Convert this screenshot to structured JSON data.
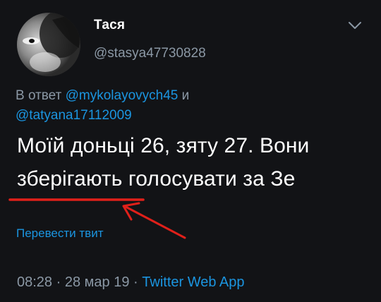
{
  "author": {
    "display_name": "Тася",
    "handle": "@stasya47730828"
  },
  "reply": {
    "prefix": "В ответ",
    "mention_1": "@mykolayovych45",
    "conjunction": "и",
    "mention_2": "@tatyana17112009"
  },
  "tweet": {
    "line_1": "Моїй доньці 26, зяту 27. Вони",
    "line_2": "зберігають голосувати за Зе"
  },
  "translate_label": "Перевести твит",
  "meta": {
    "time": "08:28",
    "separator": "·",
    "date": "28 мар 19",
    "source": "Twitter Web App"
  },
  "icons": {
    "menu": "chevron-down-icon",
    "annotation": "red-arrow"
  },
  "colors": {
    "background": "#121316",
    "text": "#ffffff",
    "secondary": "#8b98a5",
    "link": "#1b95e0",
    "annotation": "#e0201a"
  }
}
